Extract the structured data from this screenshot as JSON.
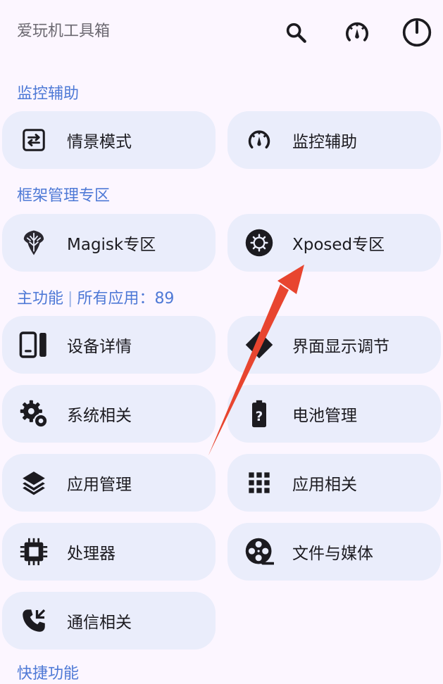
{
  "app_bar": {
    "title": "爱玩机工具箱",
    "actions": [
      "search-icon",
      "speedometer-icon",
      "power-icon"
    ]
  },
  "sections": {
    "monitor": {
      "title": "监控辅助",
      "items": [
        {
          "label": "情景模式",
          "icon": "swap-arrows-icon"
        },
        {
          "label": "监控辅助",
          "icon": "speedometer-icon"
        }
      ]
    },
    "framework": {
      "title": "框架管理专区",
      "items": [
        {
          "label": "Magisk专区",
          "icon": "magisk-icon"
        },
        {
          "label": "Xposed专区",
          "icon": "xposed-icon"
        }
      ]
    },
    "main": {
      "title": "主功能",
      "separator": "|",
      "app_count_label": "所有应用：89",
      "items": [
        {
          "label": "设备详情",
          "icon": "device-icon"
        },
        {
          "label": "界面显示调节",
          "icon": "display-icon"
        },
        {
          "label": "系统相关",
          "icon": "gear-icon"
        },
        {
          "label": "电池管理",
          "icon": "battery-icon"
        },
        {
          "label": "应用管理",
          "icon": "layers-icon"
        },
        {
          "label": "应用相关",
          "icon": "grid-icon"
        },
        {
          "label": "处理器",
          "icon": "chip-icon"
        },
        {
          "label": "文件与媒体",
          "icon": "film-reel-icon"
        },
        {
          "label": "通信相关",
          "icon": "phone-icon"
        }
      ]
    },
    "shortcut": {
      "title": "快捷功能"
    }
  },
  "colors": {
    "background": "#fcf6ff",
    "card": "#eaedfb",
    "section_title": "#4e79d6",
    "annotation_arrow": "#e8452f"
  }
}
